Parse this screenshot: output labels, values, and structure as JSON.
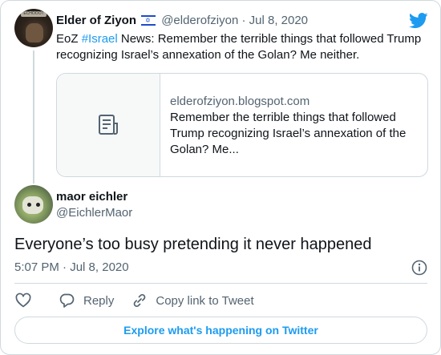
{
  "parent": {
    "author_name": "Elder of Ziyon",
    "handle": "@elderofziyon",
    "separator": "·",
    "date": "Jul 8, 2020",
    "avatar_label": "ECHOOOT",
    "text_prefix": "EoZ ",
    "hashtag": "#Israel",
    "text_rest": " News: Remember the terrible things that followed Trump recognizing Israel’s annexation of the Golan? Me neither.",
    "link_card": {
      "domain": "elderofziyon.blogspot.com",
      "title": "Remember the terrible things that followed Trump recognizing Israel’s annexation of the Golan? Me..."
    }
  },
  "reply": {
    "author_name": "maor eichler",
    "handle": "@EichlerMaor",
    "text": "Everyone’s too busy pretending it never happened",
    "time": "5:07 PM",
    "separator": "·",
    "date": "Jul 8, 2020"
  },
  "actions": {
    "reply_label": "Reply",
    "copy_link_label": "Copy link to Tweet"
  },
  "explore_label": "Explore what's happening on Twitter",
  "icons": [
    "israel-flag-icon",
    "twitter-bird-icon",
    "article-icon",
    "info-icon",
    "heart-icon",
    "reply-icon",
    "link-icon"
  ],
  "colors": {
    "accent": "#1d9bf0",
    "muted_text": "#536471",
    "border": "#cfd9de",
    "text": "#0f1419"
  }
}
